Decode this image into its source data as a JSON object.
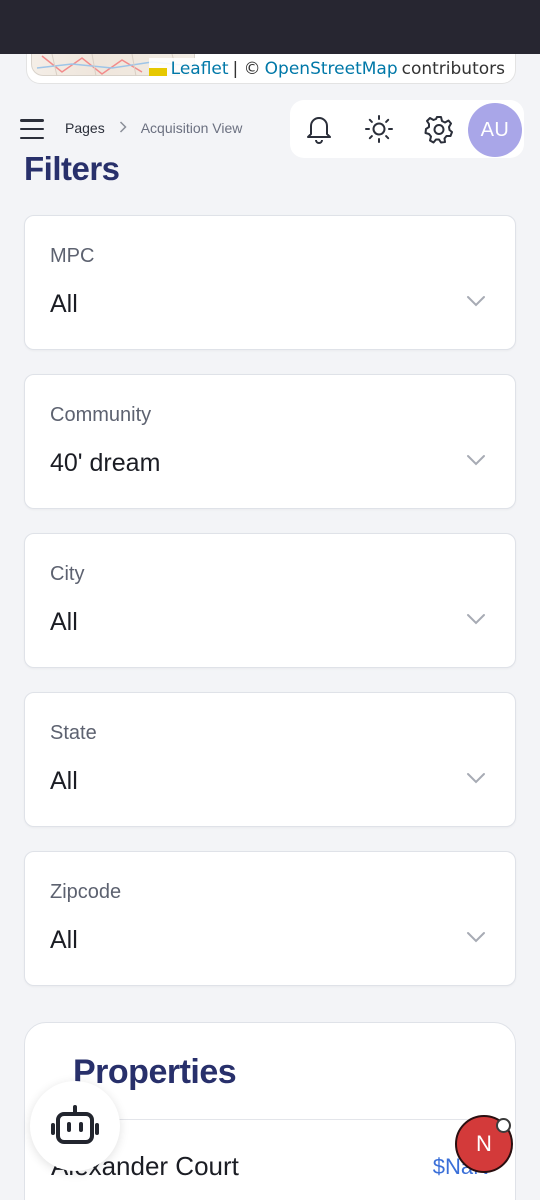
{
  "map": {
    "attribution_leaflet": "Leaflet",
    "attribution_sep": "| ©",
    "attribution_osm": "OpenStreetMap",
    "attribution_suffix": "contributors"
  },
  "header": {
    "breadcrumb": [
      "Pages",
      "Acquisition View"
    ],
    "breadcrumb_separator": ">",
    "avatar_initials": "AU",
    "icons": [
      "bell-icon",
      "sun-icon",
      "gear-icon"
    ]
  },
  "filters": {
    "title": "Filters",
    "items": [
      {
        "label": "MPC",
        "value": "All"
      },
      {
        "label": "Community",
        "value": "40' dream"
      },
      {
        "label": "City",
        "value": "All"
      },
      {
        "label": "State",
        "value": "All"
      },
      {
        "label": "Zipcode",
        "value": "All"
      }
    ]
  },
  "properties": {
    "title": "Properties",
    "rows": [
      {
        "name": "Alexander Court",
        "price": "$NaN"
      }
    ]
  },
  "floating": {
    "bot_icon": "robot-icon",
    "badge_letter": "N"
  },
  "colors": {
    "accent_title": "#28306b",
    "avatar_bg": "#a9a6e8",
    "link": "#0078a8",
    "price": "#3a6fd8",
    "badge": "#d33a3a"
  }
}
